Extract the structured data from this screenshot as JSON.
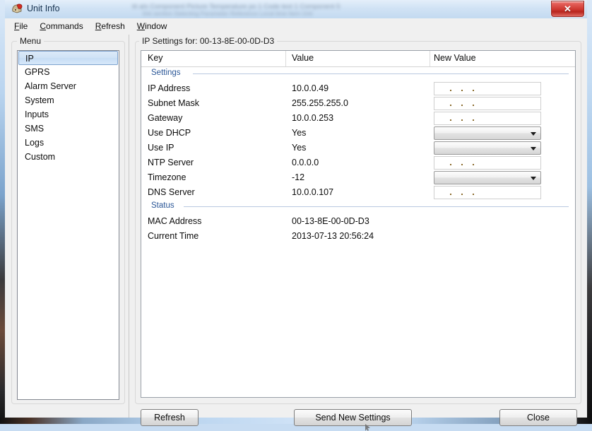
{
  "window": {
    "title": "Unit Info",
    "icon": "helmet-icon",
    "close_label": "✕",
    "accent_red": "#cf3a33",
    "accent_blue": "#2b5797"
  },
  "menubar": {
    "items": [
      {
        "label": "File",
        "accel": "F"
      },
      {
        "label": "Commands",
        "accel": "C"
      },
      {
        "label": "Refresh",
        "accel": "R"
      },
      {
        "label": "Window",
        "accel": "W"
      }
    ]
  },
  "sidebar": {
    "group_label": "Menu",
    "selected": "IP",
    "items": [
      {
        "label": "IP"
      },
      {
        "label": "GPRS"
      },
      {
        "label": "Alarm Server"
      },
      {
        "label": "System"
      },
      {
        "label": "Inputs"
      },
      {
        "label": "SMS"
      },
      {
        "label": "Logs"
      },
      {
        "label": "Custom"
      }
    ]
  },
  "main": {
    "group_label": "IP Settings for: 00-13-8E-00-0D-D3",
    "columns": [
      "Key",
      "Value",
      "New Value"
    ],
    "sections": [
      {
        "label": "Settings",
        "rows": [
          {
            "key": "IP Address",
            "value": "10.0.0.49",
            "editor": "ip"
          },
          {
            "key": "Subnet Mask",
            "value": "255.255.255.0",
            "editor": "ip"
          },
          {
            "key": "Gateway",
            "value": "10.0.0.253",
            "editor": "ip"
          },
          {
            "key": "Use DHCP",
            "value": "Yes",
            "editor": "combo"
          },
          {
            "key": "Use IP",
            "value": "Yes",
            "editor": "combo"
          },
          {
            "key": "NTP Server",
            "value": "0.0.0.0",
            "editor": "ip"
          },
          {
            "key": "Timezone",
            "value": "-12",
            "editor": "combo"
          },
          {
            "key": "DNS Server",
            "value": "10.0.0.107",
            "editor": "ip"
          }
        ]
      },
      {
        "label": "Status",
        "rows": [
          {
            "key": "MAC Address",
            "value": "00-13-8E-00-0D-D3",
            "editor": "none"
          },
          {
            "key": "Current Time",
            "value": "2013-07-13 20:56:24",
            "editor": "none"
          }
        ]
      }
    ]
  },
  "footer": {
    "refresh_label": "Refresh",
    "send_label": "Send New Settings",
    "close_label": "Close"
  },
  "backdrop": {
    "line1": "tit ats   Component Picture   Temperature po 1   Code   text 1   Component 5",
    "line2": "link   section   Selecting   Parameter   Reference   Local time   Item   Unit"
  }
}
